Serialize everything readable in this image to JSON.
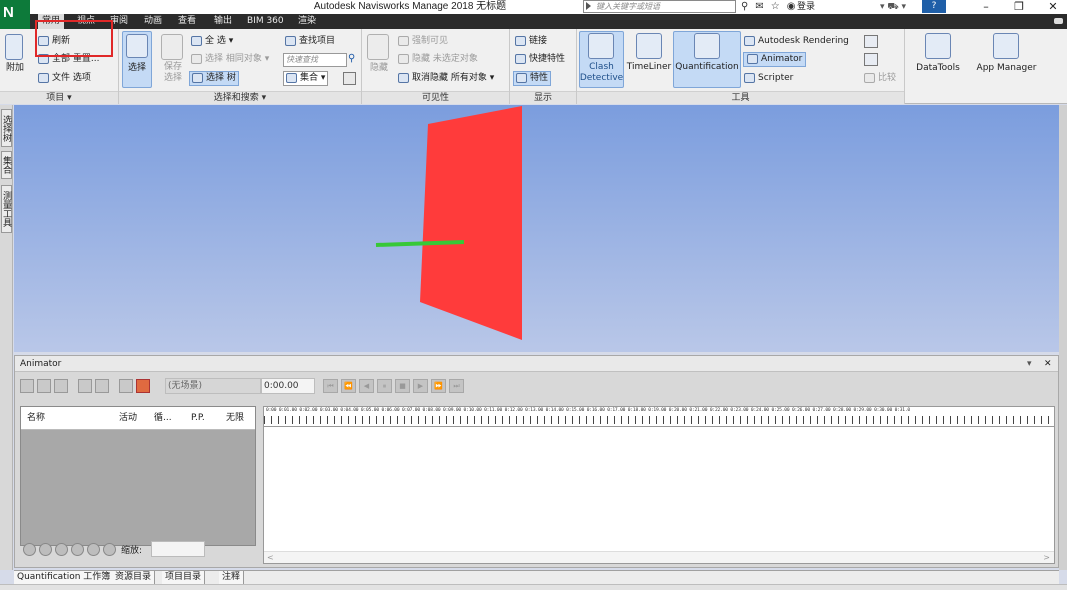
{
  "app": {
    "logo_letter": "N",
    "window_title": "Autodesk Navisworks Manage 2018    无标题",
    "search_placeholder": "键入关键字或短语",
    "login_label": "登录",
    "help_label": "?"
  },
  "tabs": [
    "常用",
    "视点",
    "审阅",
    "动画",
    "查看",
    "输出",
    "BIM 360",
    "渲染"
  ],
  "ribbon": {
    "project": {
      "append_label": "附加",
      "refresh_label": "刷新",
      "reset_all_label": "全部 重置...",
      "file_options_label": "文件 选项",
      "group_label": "项目 ▾"
    },
    "selection": {
      "select_label": "选择",
      "save_selection_label": "保存\n选择",
      "select_all_label": "全 选",
      "select_same_label": "选择 相同对象",
      "selection_tree_label": "选择 树",
      "find_items_label": "查找项目",
      "quick_find_placeholder": "快速查找",
      "sets_label": "集合",
      "group_label": "选择和搜索 ▾"
    },
    "visibility": {
      "hide_label": "隐藏",
      "require_label": "强制可见",
      "hide_unselected_label": "隐藏 未选定对象",
      "unhide_all_label": "取消隐藏 所有对象",
      "group_label": "可见性"
    },
    "display": {
      "links_label": "链接",
      "quick_props_label": "快捷特性",
      "properties_label": "特性",
      "group_label": "显示"
    },
    "tools": {
      "clash_detective_label": "Clash\nDetective",
      "timeliner_label": "TimeLiner",
      "quantification_label": "Quantification",
      "autodesk_rendering_label": "Autodesk Rendering",
      "animator_label": "Animator",
      "scripter_label": "Scripter",
      "compare_label": "比较",
      "group_label": "工具"
    },
    "datatools_label": "DataTools",
    "app_manager_label": "App Manager"
  },
  "left_tabs": [
    "选择树",
    "集合",
    "测量工具"
  ],
  "animator": {
    "title": "Animator",
    "scene_placeholder": "(无场景)",
    "time_value": "0:00.00",
    "columns": [
      "名称",
      "活动",
      "循...",
      "P.P.",
      "无限"
    ],
    "zoom_label": "缩放:",
    "ruler_text": "0:00 0:01.00 0:02.00 0:03.00 0:04.00 0:05.00 0:06.00 0:07.00 0:08.00 0:09.00 0:10.00 0:11.00 0:12.00 0:13.00 0:14.00 0:15.00 0:16.00 0:17.00 0:18.00 0:19.00 0:20.00 0:21.00 0:22.00 0:23.00 0:24.00 0:25.00 0:26.00 0:27.00 0:28.00 0:29.00 0:30.00 0:31.0"
  },
  "bottom_tabs": [
    "Quantification 工作簿",
    "资源目录",
    "项目目录",
    "注释"
  ],
  "colors": {
    "panel_red": "#ff3b3b",
    "line_green": "#37c837",
    "viewport_top": "#7b9dde",
    "viewport_bottom": "#b9c7e8"
  }
}
